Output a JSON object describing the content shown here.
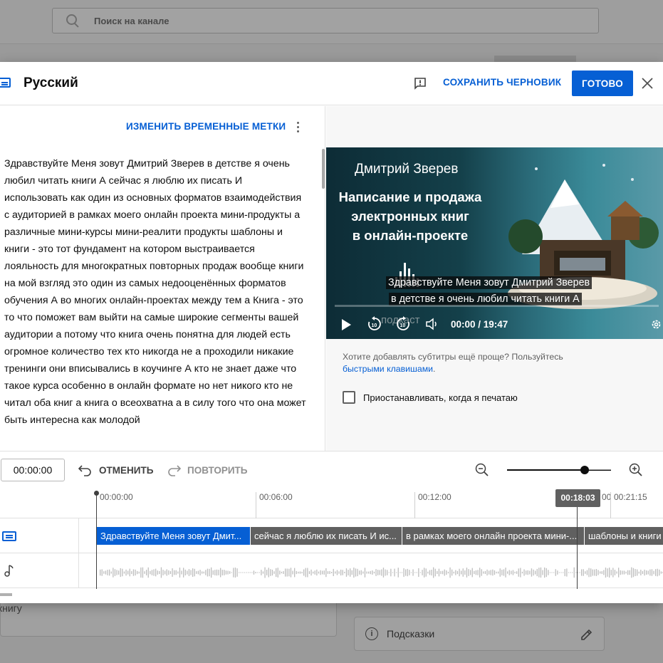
{
  "background": {
    "search_placeholder": "Поиск на канале",
    "bottom_left_text": "книгу",
    "hints_label": "Подсказки"
  },
  "modal": {
    "title": "Русский",
    "save_draft": "СОХРАНИТЬ ЧЕРНОВИК",
    "done": "ГОТОВО"
  },
  "editor": {
    "edit_timestamps": "ИЗМЕНИТЬ ВРЕМЕННЫЕ МЕТКИ",
    "transcript": "Здравствуйте Меня зовут Дмитрий Зверев в детстве я очень любил читать книги А сейчас я люблю их писать И использовать как один из основных форматов взаимодействия с аудиторией в рамках моего онлайн проекта мини-продукты а различные мини-курсы мини-реалити продукты шаблоны и книги - это тот фундамент на котором выстраивается лояльность для многократных повторных продаж вообще книги на мой взгляд это один из самых недооценённых форматов обучения А во многих онлайн-проектах между тем а Книга - это то что поможет вам выйти на самые широкие сегменты вашей аудитории а потому что книга очень понятна для людей есть огромное количество тех кто никогда не а проходили никакие тренинги они вписывались в коучинге А кто не знает даже что такое курса особенно в онлайн формате но нет никого кто не читал оба книг а книга о всеохватна а в силу того что она может быть интересна как молодой"
  },
  "video": {
    "author": "Дмитрий Зверев",
    "title_lines": [
      "Написание и продажа",
      "электронных книг",
      "в онлайн-проекте"
    ],
    "subtitle_line1": "Здравствуйте Меня зовут Дмитрий Зверев",
    "subtitle_line2": "в детстве я очень любил читать книги А",
    "podcast_text": "подкаст",
    "time": "00:00 / 19:47",
    "progress": 0
  },
  "side": {
    "hint_text": "Хотите добавлять субтитры ещё проще? Пользуйтесь",
    "hint_link": "быстрыми клавишами",
    "hint_end": ".",
    "pause_label": "Приостанавливать, когда я печатаю"
  },
  "toolbar": {
    "time_value": "00:00:00",
    "undo": "ОТМЕНИТЬ",
    "redo": "ПОВТОРИТЬ",
    "zoom_level": 0.75
  },
  "timeline": {
    "ticks": [
      "00:00:00",
      "00:06:00",
      "00:12:00",
      "00:21:15"
    ],
    "tick_partial": "00",
    "playhead": "00:18:03",
    "segments": [
      "Здравствуйте Меня зовут Дмит...",
      "сейчас я люблю их писать И ис...",
      "в рамках моего онлайн проекта мини-...",
      "шаблоны и книги -"
    ]
  },
  "colors": {
    "accent": "#065fd4",
    "segment": "#606060"
  }
}
